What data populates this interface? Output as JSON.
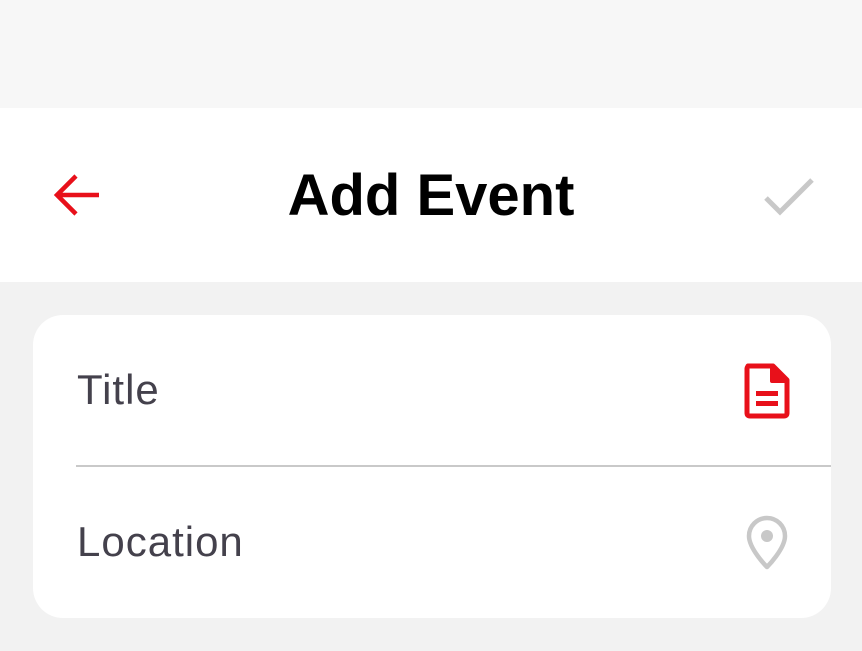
{
  "header": {
    "title": "Add Event",
    "back_icon": "arrow-left-icon",
    "confirm_icon": "checkmark-icon"
  },
  "form": {
    "fields": [
      {
        "label": "Title",
        "icon": "document-icon",
        "icon_color": "#e8101a"
      },
      {
        "label": "Location",
        "icon": "map-pin-icon",
        "icon_color": "#c8c8c8"
      }
    ]
  },
  "colors": {
    "accent": "#e8101a",
    "disabled": "#c8c8c8",
    "label_text": "#44414c",
    "title_text": "#000000",
    "background": "#f2f2f2",
    "status_bar": "#f7f7f7"
  }
}
